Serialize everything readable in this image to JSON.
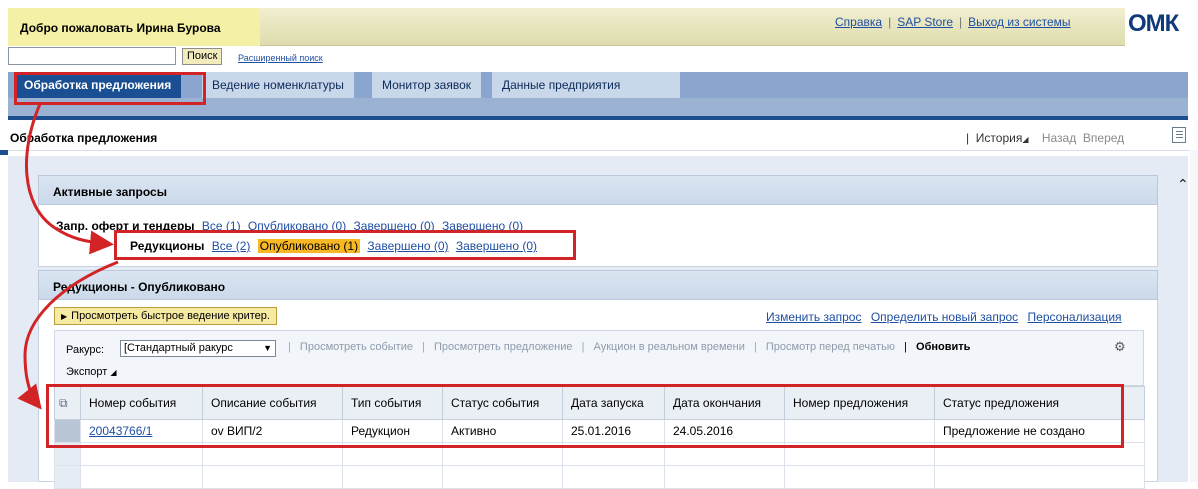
{
  "header": {
    "welcome": "Добро пожаловать Ирина Бурова",
    "links": [
      "Справка",
      "SAP Store",
      "Выход из системы"
    ],
    "logo_text": "ОМК"
  },
  "search": {
    "button": "Поиск",
    "advanced": "Расширенный поиск"
  },
  "nav": {
    "tabs": [
      "Обработка предложения",
      "Ведение номенклатуры",
      "Монитор заявок",
      "Данные предприятия"
    ]
  },
  "page": {
    "title": "Обработка предложения",
    "history": "История",
    "back": "Назад",
    "forward": "Вперед"
  },
  "active_queries": {
    "title": "Активные запросы",
    "row1": {
      "label": "Запр. оферт и тендеры",
      "links": [
        "Все (1)",
        "Опубликовано (0)",
        "Завершено (0)",
        "Завершено (0)"
      ]
    },
    "row2": {
      "label": "Редукционы",
      "links": [
        "Все (2)",
        "Опубликовано (1)",
        "Завершено (0)",
        "Завершено (0)"
      ]
    }
  },
  "results": {
    "title": "Редукционы - Опубликовано",
    "quick_button": "Просмотреть быстрое ведение критер.",
    "right_links": [
      "Изменить запрос",
      "Определить новый запрос",
      "Персонализация"
    ],
    "view_label": "Ракурс:",
    "view_value": "[Стандартный ракурс",
    "toolbar": [
      "Просмотреть событие",
      "Просмотреть предложение",
      "Аукцион в реальном времени",
      "Просмотр перед печатью",
      "Обновить"
    ],
    "export": "Экспорт"
  },
  "table": {
    "columns": [
      "Номер события",
      "Описание события",
      "Тип события",
      "Статус события",
      "Дата запуска",
      "Дата окончания",
      "Номер предложения",
      "Статус предложения"
    ],
    "rows": [
      [
        "20043766/1",
        "ov ВИП/2",
        "Редукцион",
        "Активно",
        "25.01.2016",
        "24.05.2016",
        "",
        "Предложение не создано"
      ]
    ]
  },
  "colors": {
    "highlight": "#d22427",
    "nav_active": "#1b4f93",
    "badge_orange": "#f7b824"
  }
}
